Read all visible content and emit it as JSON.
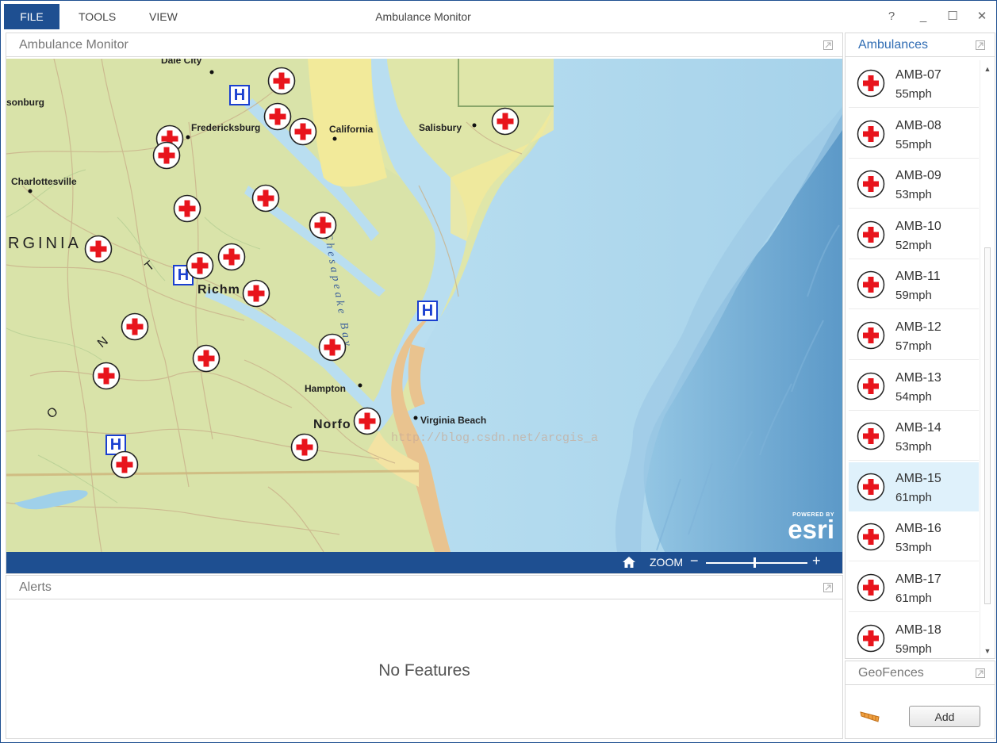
{
  "window": {
    "title": "Ambulance Monitor",
    "menu": [
      "FILE",
      "TOOLS",
      "VIEW"
    ],
    "controls": {
      "help": "?",
      "minimize": "_",
      "maximize": "☐",
      "close": "✕"
    }
  },
  "map_panel": {
    "title": "Ambulance Monitor",
    "labels": {
      "dale_city": "Dale City",
      "harrisonburg": "sonburg",
      "fredericksburg": "Fredericksburg",
      "california": "California",
      "salisbury": "Salisbury",
      "charlottesville": "Charlottesville",
      "virginia": "RGINIA",
      "richmond": "Richm",
      "hampton": "Hampton",
      "norfolk": "Norfo",
      "virginia_beach": "Virginia Beach",
      "chesapeake_bay": "Chesapeake Bay",
      "n": "N",
      "t": "T",
      "o": "O"
    },
    "watermark": "http://blog.csdn.net/arcgis_a",
    "esri": {
      "powered_by": "POWERED BY",
      "brand": "esri"
    },
    "toolbar": {
      "zoom_label": "ZOOM",
      "minus": "−",
      "plus": "+"
    },
    "zoom_level_fraction": 0.47
  },
  "alerts_panel": {
    "title": "Alerts",
    "empty_message": "No Features"
  },
  "ambulances_panel": {
    "title": "Ambulances",
    "items": [
      {
        "name": "AMB-07",
        "speed": "55mph",
        "selected": false
      },
      {
        "name": "AMB-08",
        "speed": "55mph",
        "selected": false
      },
      {
        "name": "AMB-09",
        "speed": "53mph",
        "selected": false
      },
      {
        "name": "AMB-10",
        "speed": "52mph",
        "selected": false
      },
      {
        "name": "AMB-11",
        "speed": "59mph",
        "selected": false
      },
      {
        "name": "AMB-12",
        "speed": "57mph",
        "selected": false
      },
      {
        "name": "AMB-13",
        "speed": "54mph",
        "selected": false
      },
      {
        "name": "AMB-14",
        "speed": "53mph",
        "selected": false
      },
      {
        "name": "AMB-15",
        "speed": "61mph",
        "selected": true
      },
      {
        "name": "AMB-16",
        "speed": "53mph",
        "selected": false
      },
      {
        "name": "AMB-17",
        "speed": "61mph",
        "selected": false
      },
      {
        "name": "AMB-18",
        "speed": "59mph",
        "selected": false
      }
    ],
    "scroll_up": "▲",
    "scroll_down": "▼"
  },
  "geofences_panel": {
    "title": "GeoFences",
    "add_label": "Add"
  },
  "colors": {
    "accent": "#1e4f91",
    "selected_row": "#dff1fb",
    "marker_red": "#e8141c",
    "hospital_blue": "#1a3fd0",
    "water": "#b8dcef",
    "land": "#d9e3a9"
  },
  "icons": {
    "ambulance": "red-cross-icon",
    "hospital": "hospital-h-icon",
    "pin": "pin-icon",
    "home": "home-icon",
    "geofence": "geofence-icon"
  }
}
